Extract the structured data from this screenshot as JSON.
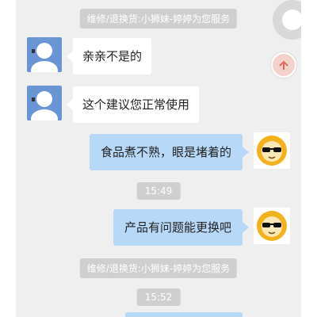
{
  "chat": {
    "messages": [
      {
        "type": "system",
        "text": "维修/退换货:小狮妹-婷婷为您服务"
      },
      {
        "type": "incoming",
        "text": "亲亲不是的"
      },
      {
        "type": "incoming",
        "text": "这个建议您正常使用"
      },
      {
        "type": "outgoing",
        "text": "食品煮不熟，眼是堵着的"
      },
      {
        "type": "time",
        "text": "15:49"
      },
      {
        "type": "outgoing",
        "text": "产品有问题能更换吧"
      },
      {
        "type": "system",
        "text": "维修/退换货:小狮妹-婷婷为您服务"
      },
      {
        "type": "time",
        "text": "15:52"
      }
    ]
  },
  "icons": {
    "user_avatar": "default-user-avatar-icon",
    "agent_avatar": "lion-sunglasses-avatar-icon",
    "floating": "floating-menu-icon",
    "refund": "refund-icon"
  },
  "colors": {
    "background": "#efefef",
    "outgoing_bubble": "#b7d8f7",
    "incoming_bubble": "#ffffff",
    "system_label": "#cfcfcf",
    "user_avatar_bg": "#6a95d4",
    "lion_mane": "#f2b21c"
  }
}
